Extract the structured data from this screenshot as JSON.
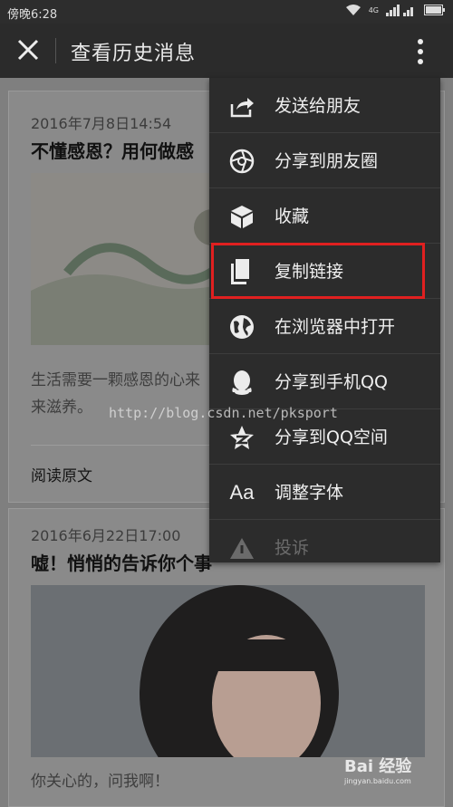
{
  "status_bar": {
    "time": "傍晚6:28",
    "network": "4G"
  },
  "top_bar": {
    "title": "查看历史消息"
  },
  "articles": [
    {
      "date": "2016年7月8日14:54",
      "title": "不懂感恩？用何做感",
      "summary": "生活需要一颗感恩的心来来滋养。",
      "read_more": "阅读原文"
    },
    {
      "date": "2016年6月22日17:00",
      "title": "嘘！悄悄的告诉你个事",
      "summary": "你关心的，问我啊！"
    }
  ],
  "menu": {
    "items": [
      {
        "label": "发送给朋友",
        "icon": "share-icon"
      },
      {
        "label": "分享到朋友圈",
        "icon": "moments-icon"
      },
      {
        "label": "收藏",
        "icon": "favorite-icon"
      },
      {
        "label": "复制链接",
        "icon": "copy-link-icon"
      },
      {
        "label": "在浏览器中打开",
        "icon": "browser-icon"
      },
      {
        "label": "分享到手机QQ",
        "icon": "qq-icon"
      },
      {
        "label": "分享到QQ空间",
        "icon": "qzone-icon"
      },
      {
        "label": "调整字体",
        "icon": "font-icon",
        "icon_text": "Aa"
      },
      {
        "label": "投诉",
        "icon": "warning-icon"
      }
    ],
    "highlight_color": "#e02020"
  },
  "watermark": "http://blog.csdn.net/pksport",
  "baidu_watermark": {
    "brand": "Bai 经验",
    "url": "jingyan.baidu.com"
  }
}
